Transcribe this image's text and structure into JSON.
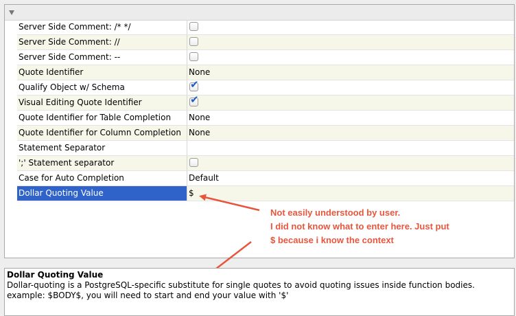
{
  "properties": [
    {
      "name": "Server Side Comment: /* */",
      "type": "checkbox",
      "checked": false,
      "value": ""
    },
    {
      "name": "Server Side Comment: //",
      "type": "checkbox",
      "checked": false,
      "value": ""
    },
    {
      "name": "Server Side Comment: --",
      "type": "checkbox",
      "checked": false,
      "value": ""
    },
    {
      "name": "Quote Identifier",
      "type": "text",
      "checked": false,
      "value": "None"
    },
    {
      "name": "Qualify Object w/ Schema",
      "type": "checkbox",
      "checked": true,
      "value": ""
    },
    {
      "name": "Visual Editing Quote Identifier",
      "type": "checkbox",
      "checked": true,
      "value": ""
    },
    {
      "name": "Quote Identifier for Table Completion",
      "type": "text",
      "checked": false,
      "value": "None"
    },
    {
      "name": "Quote Identifier for Column Completion",
      "type": "text",
      "checked": false,
      "value": "None"
    },
    {
      "name": "Statement Separator",
      "type": "text",
      "checked": false,
      "value": ""
    },
    {
      "name": "';' Statement separator",
      "type": "checkbox",
      "checked": false,
      "value": ""
    },
    {
      "name": "Case for Auto Completion",
      "type": "text",
      "checked": false,
      "value": "Default"
    },
    {
      "name": "Dollar Quoting Value",
      "type": "text",
      "checked": false,
      "value": "$",
      "selected": true
    }
  ],
  "annotation": {
    "lines": [
      "Not easily understood by user.",
      "I did not know what to enter here. Just put",
      "$ because i know the context"
    ],
    "color": "#e8553d"
  },
  "description": {
    "title": "Dollar Quoting Value",
    "line1": "Dollar-quoting is a PostgreSQL-specific substitute for single quotes to avoid quoting issues inside function bodies.",
    "line2": "example: $BODY$, you will need to start and end your value with '$'"
  },
  "colors": {
    "selection": "#2f63c9",
    "alt_row": "#f7f7e9",
    "checkbox_tick": "#1f5cc9"
  }
}
